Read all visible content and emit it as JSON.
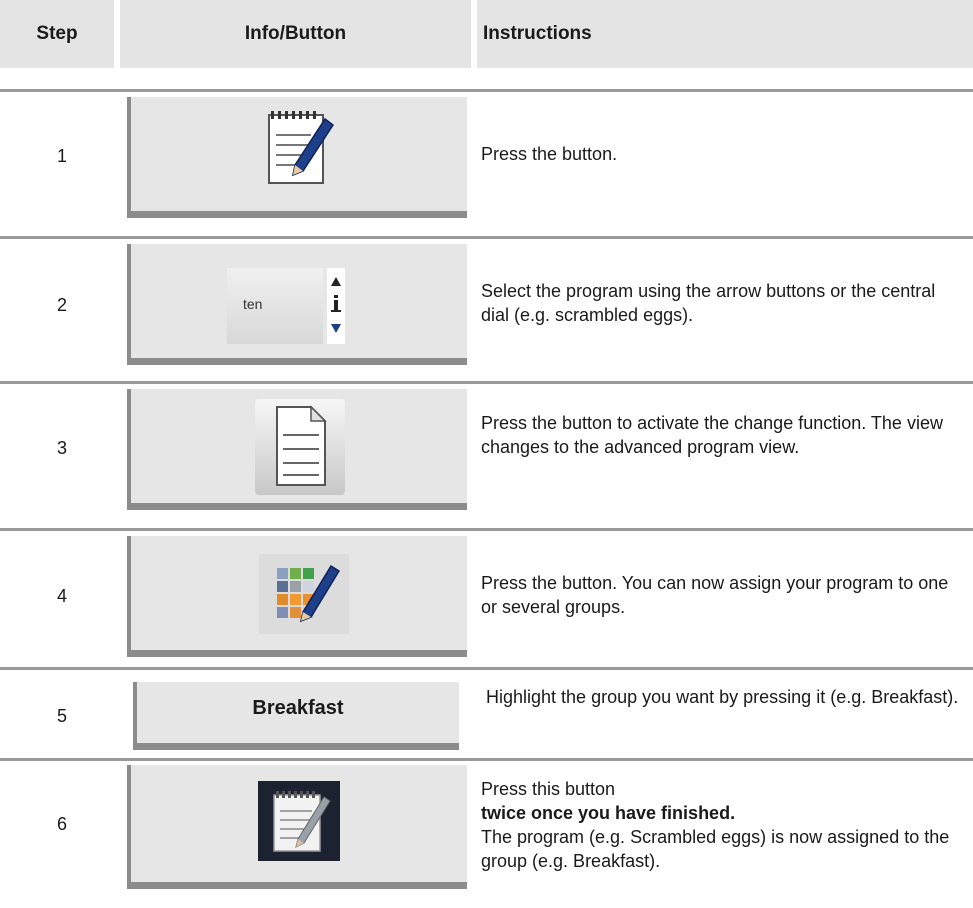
{
  "header": {
    "step": "Step",
    "info": "Info/Button",
    "instructions": "Instructions"
  },
  "rows": [
    {
      "step": "1",
      "instruction": "Press the button."
    },
    {
      "step": "2",
      "button_text": "ten",
      "instruction": "Select the program using the arrow buttons or the central dial (e.g. scrambled eggs)."
    },
    {
      "step": "3",
      "instruction": "Press the button to activate the change function. The view changes to the advanced program view."
    },
    {
      "step": "4",
      "instruction": "Press the button. You can now assign your program to one or several groups."
    },
    {
      "step": "5",
      "button_text": "Breakfast",
      "instruction": "Highlight the group you want by pressing it (e.g. Breakfast)."
    },
    {
      "step": "6",
      "instruction_line1": "Press this button",
      "instruction_bold": "twice once you have finished.",
      "instruction_line3": "The program (e.g. Scrambled eggs) is now assigned to the group (e.g. Breakfast)."
    }
  ],
  "icons": {
    "row1": "notepad-pencil-icon",
    "row2": "arrow-selector-icon",
    "row3": "document-icon",
    "row4": "group-grid-pencil-icon",
    "row6": "notepad-pencil-dark-icon"
  }
}
